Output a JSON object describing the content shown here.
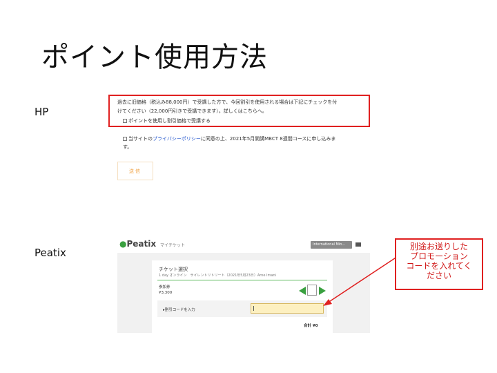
{
  "title": "ポイント使用方法",
  "hp": {
    "label": "HP",
    "notice_line1": "過去に旧価格（税込み88,000円）で受講した方で、今回割引を使用される場合は下記にチェックを付",
    "notice_line2": "けてください（22,000円引きで受講できます）。詳しくはこちらへ。",
    "point_checkbox_label": "ポイントを使用し割引価格で受講する",
    "agree_prefix": "当サイトの",
    "privacy_link": "プライバシーポリシー",
    "agree_suffix": "に同意の上、2021年5月開講MBCT 8週間コースに申し込みま",
    "agree_line2": "す。",
    "submit_label": "送信"
  },
  "peatix": {
    "label": "Peatix",
    "logo": "Peatix",
    "my_tickets": "マイチケット",
    "language": "International Min...",
    "section_title": "チケット選択",
    "event_line": "1 day オンライン　サイレントリトリート（2021年5月23日）Arne Imani",
    "ticket_name": "参加券",
    "ticket_price": "¥3,300",
    "coupon_label": "▸割引コードを入力",
    "total": "合計 ¥0"
  },
  "callout": {
    "lines": [
      "別途お送りした",
      "プロモーション",
      "コードを入れてく",
      "ださい"
    ]
  },
  "colors": {
    "callout_red": "#e02020",
    "peatix_green": "#3aa040",
    "link_blue": "#2255cc"
  }
}
